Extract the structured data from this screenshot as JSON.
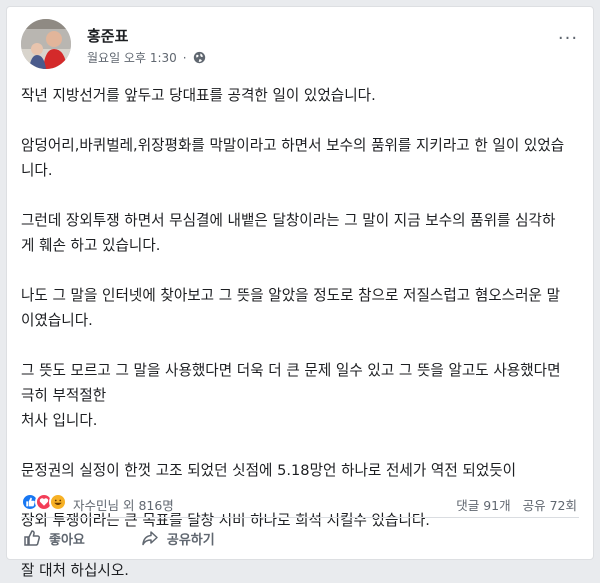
{
  "post": {
    "author": "홍준표",
    "timestamp": "월요일 오후 1:30",
    "privacy_icon": "globe-icon",
    "paragraphs": [
      "작년 지방선거를 앞두고 당대표를 공격한 일이 있었습니다.",
      "암덩어리,바퀴벌레,위장평화를 막말이라고  하면서 보수의 품위를 지키라고 한 일이 있었습니다.",
      "그런데 장외투쟁 하면서  무심결에 내뱉은 달창이라는 그 말이 지금 보수의 품위를 심각하게  훼손 하고 있습니다.",
      "나도 그 말을 인터넷에 찾아보고 그 뜻을 알았을 정도로 참으로 저질스럽고 혐오스러운 말이였습니다.",
      "그 뜻도 모르고 그 말을 사용했다면 더욱 더 큰 문제 일수 있고 그 뜻을 알고도 사용했다면 극히 부적절한\n처사 입니다.",
      "문정권의 실정이 한껏 고조 되었던 싯점에 5.18망언 하나로 전세가 역전 되었듯이",
      "장외 투쟁이라는 큰 목표를 달창 시비  하나로 희석 시킬수 있습니다.",
      "잘 대처 하십시오."
    ]
  },
  "reactions": {
    "summary": "자수민님 외 816명",
    "comments": "댓글 91개",
    "shares": "공유 72회",
    "icons": [
      "like-icon",
      "love-icon",
      "haha-icon"
    ]
  },
  "actions": {
    "like_label": "좋아요",
    "share_label": "공유하기"
  },
  "colors": {
    "like_blue": "#1877f2",
    "love_red": "#f33e58",
    "haha_yellow": "#f7b125",
    "meta_gray": "#606770"
  }
}
